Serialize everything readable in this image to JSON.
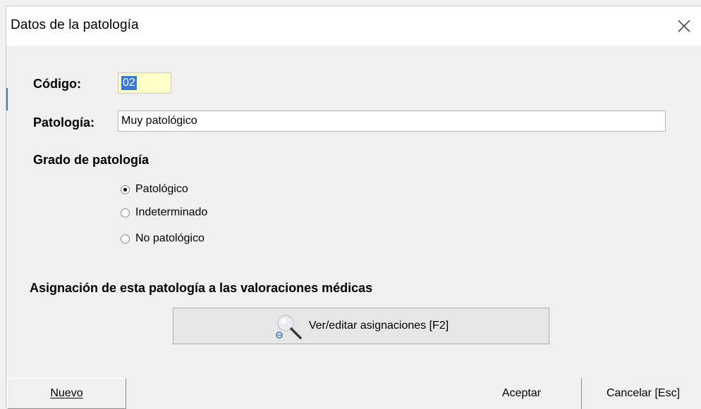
{
  "window": {
    "title": "Datos de la patología",
    "close_symbol": "×"
  },
  "form": {
    "codigo_label": "Código:",
    "codigo_value": "02",
    "patologia_label": "Patología:",
    "patologia_value": "Muy patológico",
    "grado_heading": "Grado de patología",
    "grado_options": [
      {
        "label": "Patológico",
        "selected": true
      },
      {
        "label": "Indeterminado",
        "selected": false
      },
      {
        "label": "No patológico",
        "selected": false
      }
    ],
    "asignacion_heading": "Asignación de esta patología a las valoraciones médicas",
    "ver_editar_label": "Ver/editar asignaciones  [F2]",
    "ver_editar_icon": "magnifier-icon"
  },
  "footer": {
    "nuevo_label": "Nuevo",
    "aceptar_label": "Aceptar",
    "cancelar_label": "Cancelar  [Esc]"
  },
  "colors": {
    "window_bg": "#f0f0f0",
    "code_field_bg": "#ffffc8",
    "selection": "#3a78d6"
  }
}
